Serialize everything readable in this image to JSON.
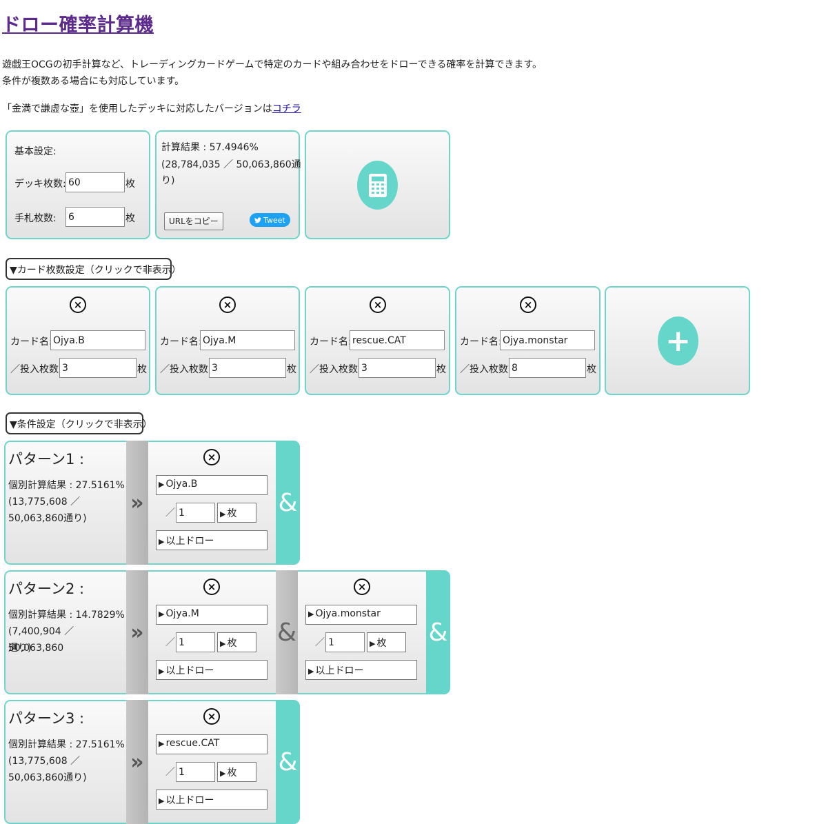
{
  "header": {
    "title": "ドロー確率計算機",
    "desc_line1": "遊戯王OCGの初手計算など、トレーディングカードゲームで特定のカードや組み合わせをドローできる確率を計算できます。",
    "desc_line2": "条件が複数ある場合にも対応しています。",
    "alt_text": "「金満で謙虚な壺」を使用したデッキに対応したバージョンは",
    "alt_link": "コチラ"
  },
  "basic": {
    "heading": "基本設定:",
    "deck_label": "デッキ枚数:",
    "deck_value": "60",
    "hand_label": "手札枚数:",
    "hand_value": "6",
    "unit": "枚"
  },
  "result": {
    "line1": "計算結果 : 57.4946%",
    "line2": "(28,784,035 ／ 50,063,860通",
    "line3": "り)",
    "copy_button": "URLをコピー",
    "tweet_button": "Tweet"
  },
  "cards_toggle": "▼カード枚数設定（クリックで非表示）",
  "cards": [
    {
      "name_label": "カード名:",
      "name": "Ojya.B",
      "count_label": "／投入枚数:",
      "count": "3",
      "unit": "枚"
    },
    {
      "name_label": "カード名:",
      "name": "Ojya.M",
      "count_label": "／投入枚数:",
      "count": "3",
      "unit": "枚"
    },
    {
      "name_label": "カード名:",
      "name": "rescue.CAT",
      "count_label": "／投入枚数:",
      "count": "3",
      "unit": "枚"
    },
    {
      "name_label": "カード名:",
      "name": "Ojya.monstar",
      "count_label": "／投入枚数:",
      "count": "8",
      "unit": "枚"
    }
  ],
  "cond_toggle": "▼条件設定（クリックで非表示）",
  "patterns": [
    {
      "title": "パターン1 :",
      "res1": "個別計算結果 : 27.5161%",
      "res2": "(13,775,608 ／",
      "res3": "50,063,860通り)",
      "conds": [
        {
          "card": "Ojya.B",
          "qty": "1",
          "unit": "枚",
          "mode": "以上ドロー"
        }
      ]
    },
    {
      "title": "パターン2 :",
      "res1": "個別計算結果 : 14.7829%",
      "res2": "(7,400,904 ／ 50,063,860",
      "res3": "通り)",
      "conds": [
        {
          "card": "Ojya.M",
          "qty": "1",
          "unit": "枚",
          "mode": "以上ドロー"
        },
        {
          "card": "Ojya.monstar",
          "qty": "1",
          "unit": "枚",
          "mode": "以上ドロー"
        }
      ]
    },
    {
      "title": "パターン3 :",
      "res1": "個別計算結果 : 27.5161%",
      "res2": "(13,775,608 ／",
      "res3": "50,063,860通り)",
      "conds": [
        {
          "card": "rescue.CAT",
          "qty": "1",
          "unit": "枚",
          "mode": "以上ドロー"
        }
      ]
    }
  ],
  "symbols": {
    "slash": "／",
    "amp": "&",
    "chevrons": "»",
    "close": "×",
    "plus": "+"
  },
  "icons": [
    "calculator-icon",
    "close-icon",
    "add-icon",
    "twitter-bird-icon",
    "chevron-right-icon"
  ],
  "colors": {
    "accent": "#66d6ca",
    "title": "#5b2a8c",
    "tweet": "#1da1f2",
    "link": "#1a0dab"
  }
}
